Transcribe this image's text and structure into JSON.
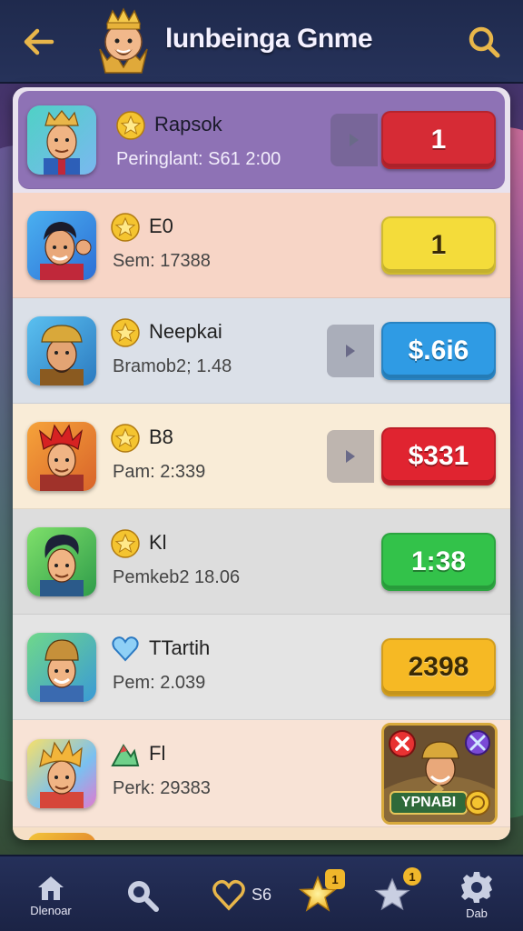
{
  "header": {
    "title": "lunbeinga Gnme",
    "back_icon": "arrow-left-icon",
    "search_icon": "search-icon",
    "logo_icon": "king-avatar-logo"
  },
  "players": [
    {
      "name": "Rapsok",
      "sub": "Peringlant: S61 2:00",
      "badge": "star-badge-icon",
      "action": "1",
      "action_color": "#d62b35",
      "has_play_tab": true,
      "bg": "#8e72b5"
    },
    {
      "name": "E0",
      "sub": "Sem: 17388",
      "badge": "star-badge-icon",
      "action": "1",
      "action_color": "#f4dc3a",
      "has_play_tab": false,
      "bg": "#f7d5c6"
    },
    {
      "name": "Neepkai",
      "sub": "Bramob2; 1.48",
      "badge": "star-badge-icon",
      "action": "$.6i6",
      "action_color": "#2f9be4",
      "has_play_tab": true,
      "bg": "#dbe0e8"
    },
    {
      "name": "B8",
      "sub": "Pam: 2:339",
      "badge": "star-badge-icon",
      "action": "$331",
      "action_color": "#e02430",
      "has_play_tab": true,
      "bg": "#f9ecd7"
    },
    {
      "name": "Kl",
      "sub": "Pemkeb2 18.06",
      "badge": "star-badge-icon",
      "action": "1:38",
      "action_color": "#33c24a",
      "has_play_tab": false,
      "bg": "#dddddd"
    },
    {
      "name": "TTartih",
      "sub": "Pem: 2.039",
      "badge": "heart-badge-icon",
      "action": "2398",
      "action_color": "#f6b924",
      "has_play_tab": false,
      "bg": "#e4e4e4"
    },
    {
      "name": "Fl",
      "sub": "Perk: 29383",
      "badge": "mountain-badge-icon",
      "action": "YPNABI",
      "action_color": "#8a6a3a",
      "has_play_tab": false,
      "bg": "#f8e3d6"
    }
  ],
  "nav": {
    "home_label": "Dlenoar",
    "hearts_count": "S6",
    "stars_badge": "1",
    "fav_badge": "1",
    "settings_label": "Dab"
  },
  "colors": {
    "header_bg": "#1f2a4d",
    "accent_gold": "#e8b64a"
  }
}
